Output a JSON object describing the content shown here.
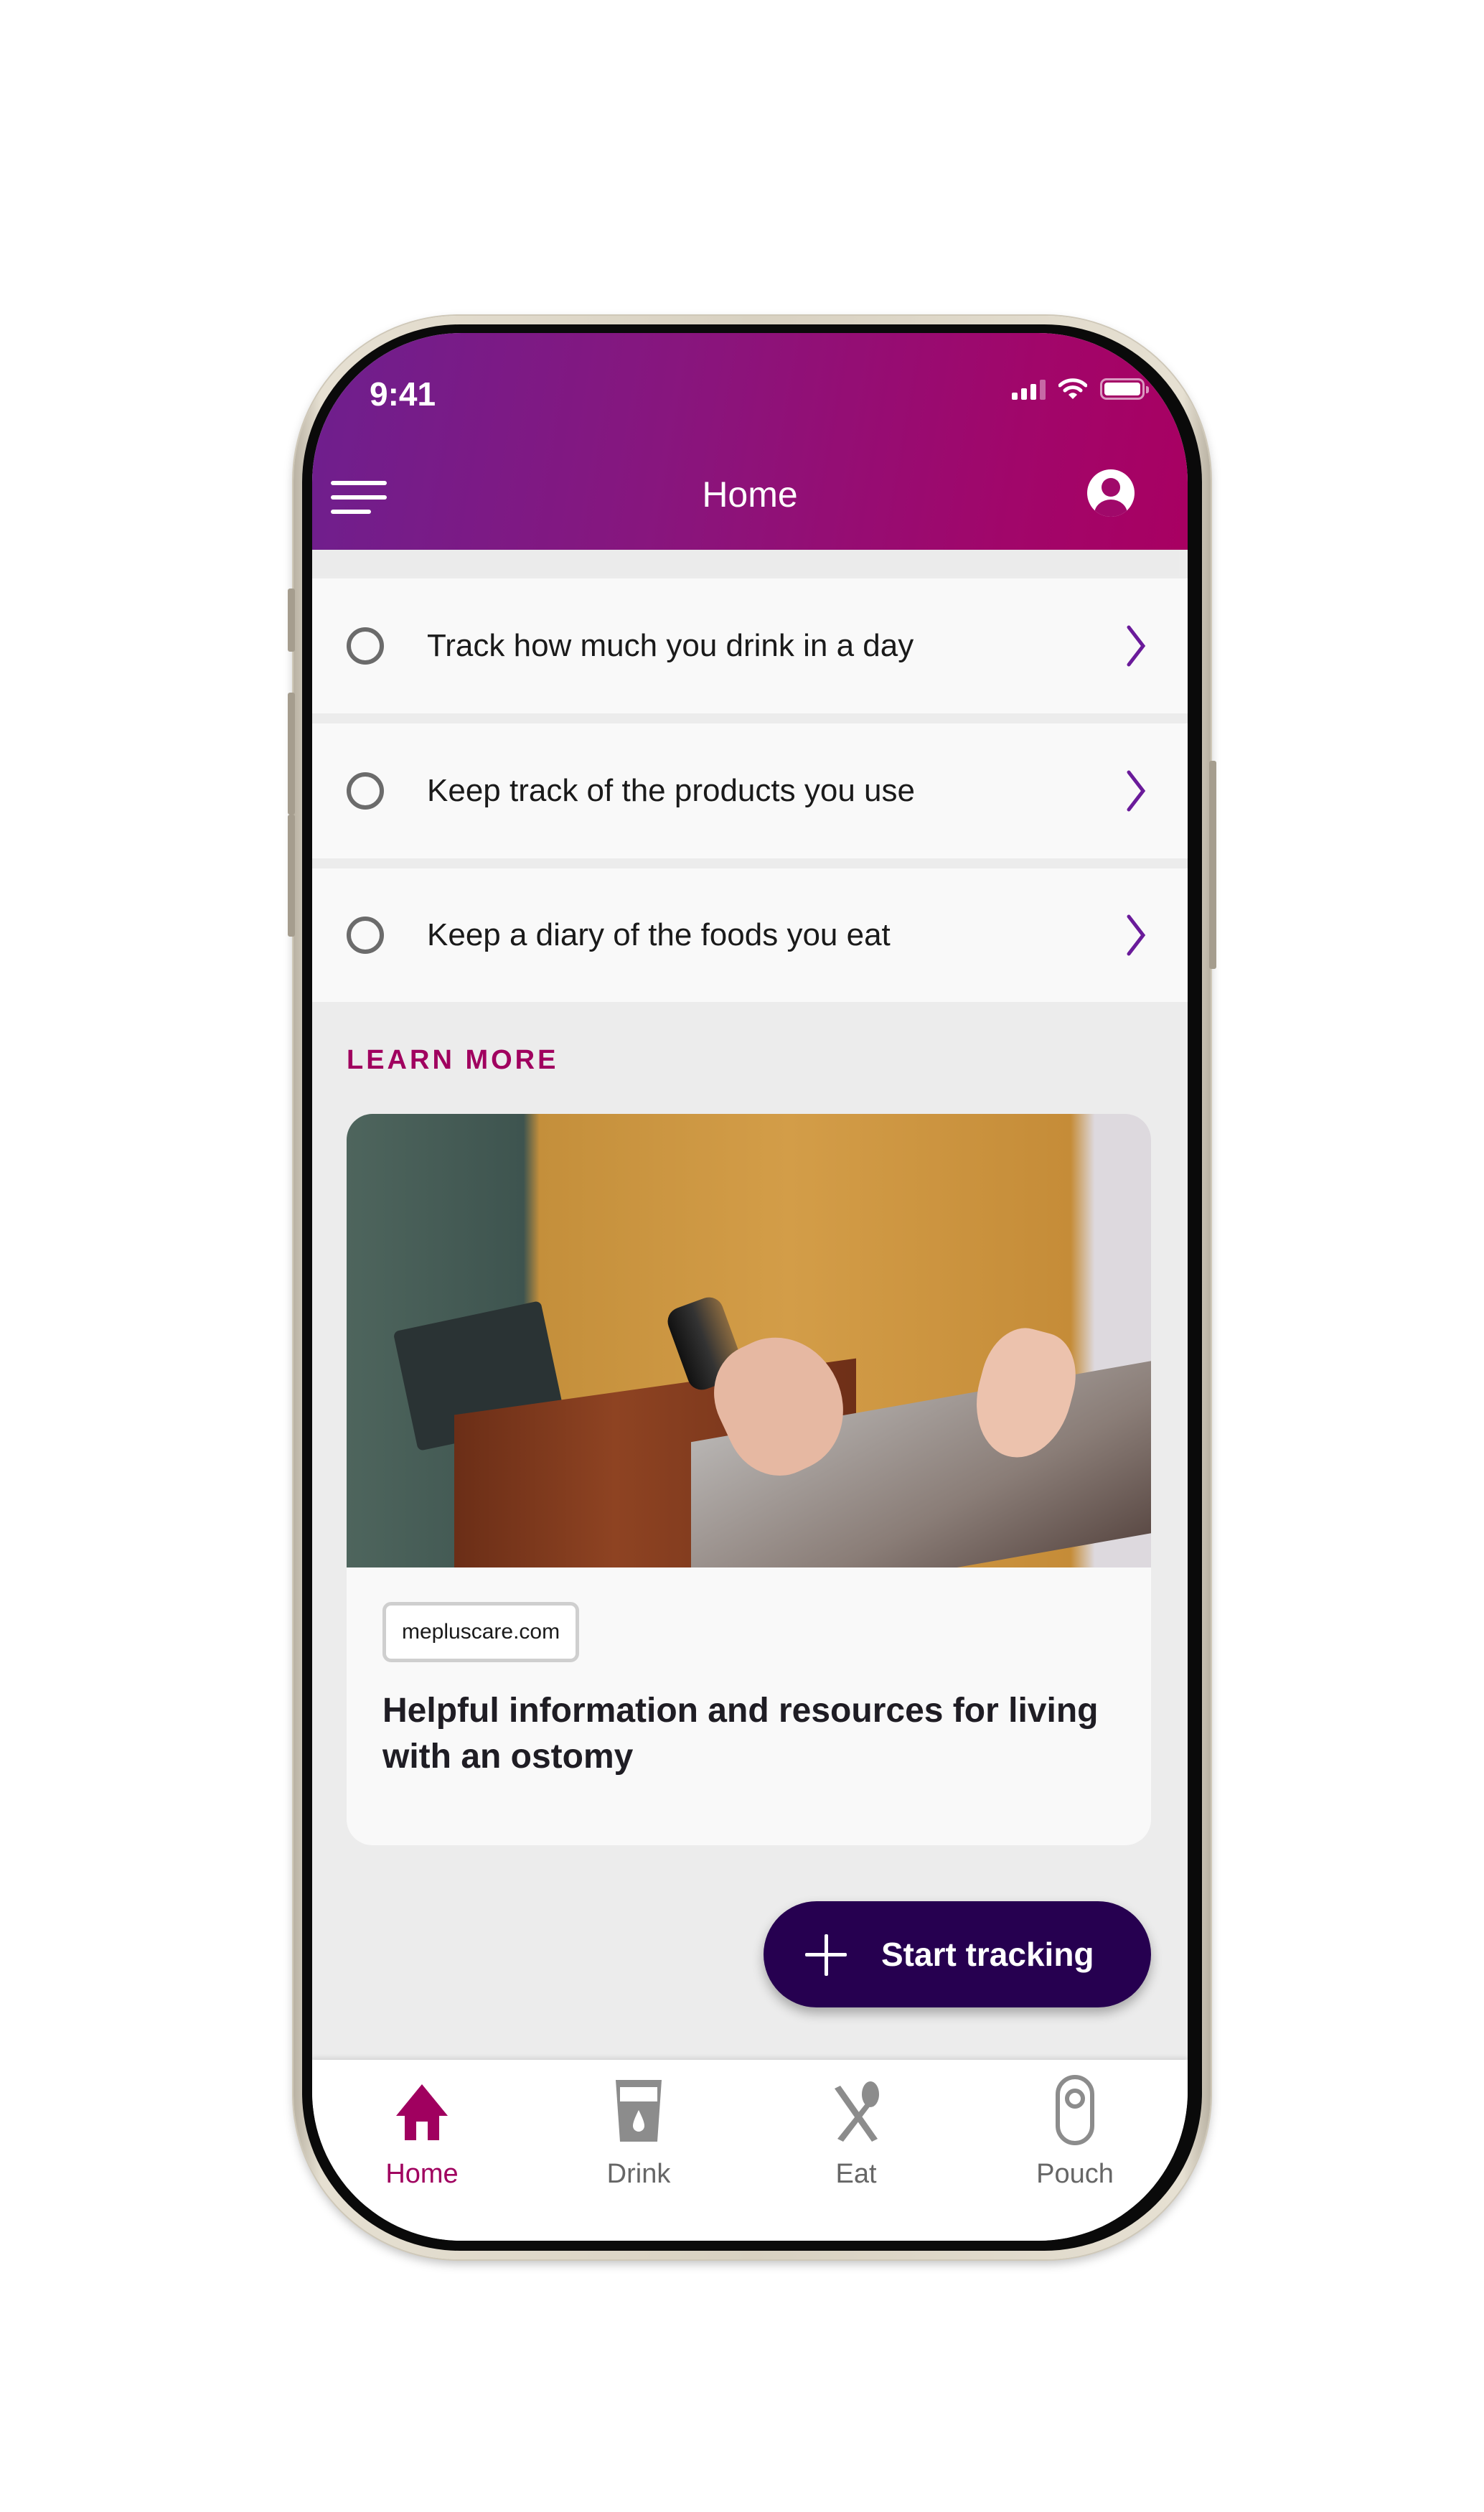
{
  "status_bar": {
    "time": "9:41",
    "icons": [
      "cellular-signal-icon",
      "wifi-icon",
      "battery-icon"
    ]
  },
  "header": {
    "title": "Home",
    "menu_icon": "hamburger-menu-icon",
    "profile_icon": "account-circle-icon"
  },
  "tasks": [
    {
      "label": "Track how much you drink in a day",
      "checked": false
    },
    {
      "label": "Keep track of the products you use",
      "checked": false
    },
    {
      "label": "Keep a diary of the foods you eat",
      "checked": false
    }
  ],
  "learn_more": {
    "heading": "LEARN MORE",
    "card": {
      "source": "mepluscare.com",
      "title": "Helpful information and resources for living with an ostomy",
      "image_alt": "Person in mustard sweater typing on a laptop"
    }
  },
  "fab": {
    "label": "Start tracking",
    "icon": "plus-icon"
  },
  "bottom_nav": {
    "active": "Home",
    "items": [
      {
        "label": "Home",
        "icon": "home-icon"
      },
      {
        "label": "Drink",
        "icon": "drink-glass-icon"
      },
      {
        "label": "Eat",
        "icon": "fork-spoon-icon"
      },
      {
        "label": "Pouch",
        "icon": "pouch-icon"
      }
    ]
  },
  "colors": {
    "brand_gradient_start": "#6e1f8e",
    "brand_gradient_end": "#a80062",
    "accent": "#a0005f",
    "chevron": "#6a1b9a",
    "fab": "#260050",
    "inactive_icon": "#8c8c8c"
  }
}
